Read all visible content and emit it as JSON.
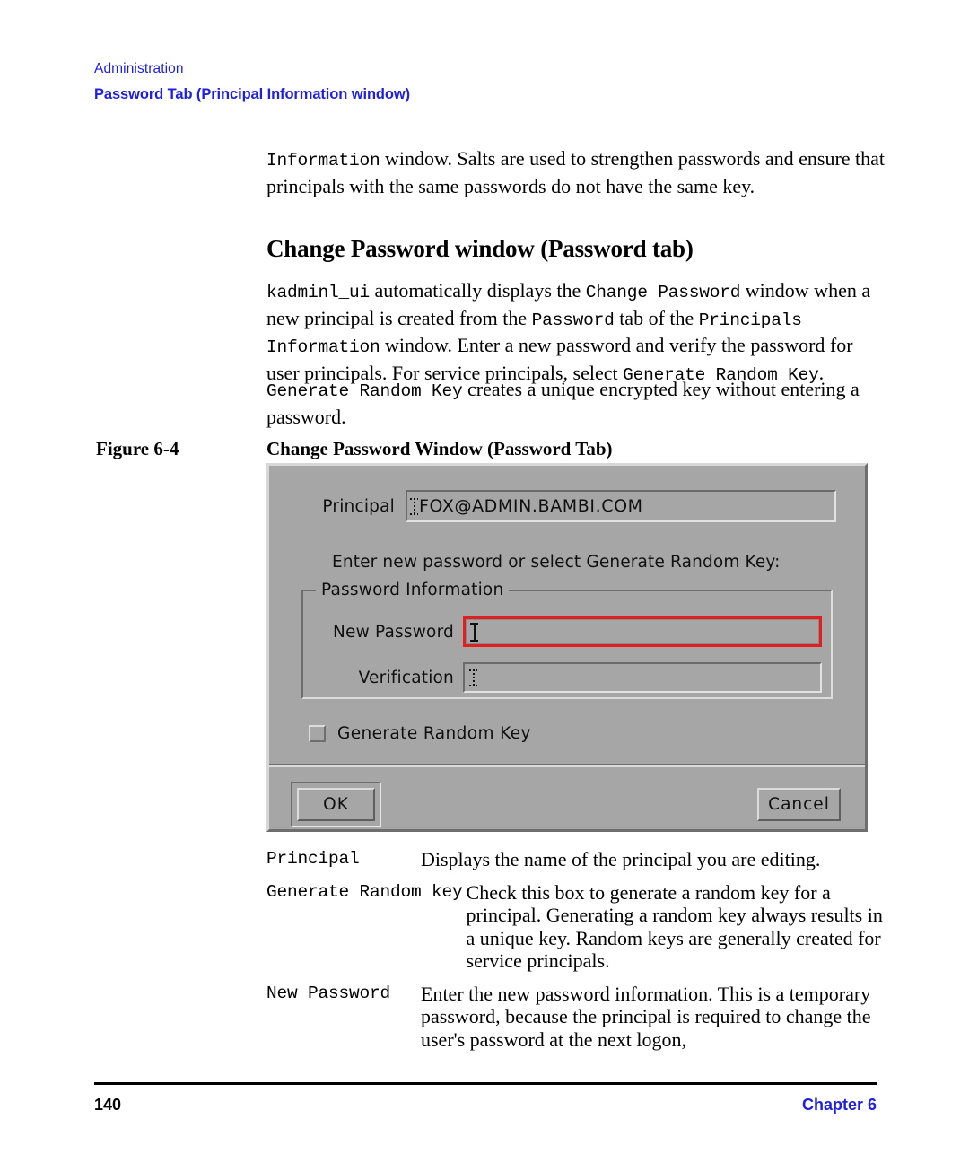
{
  "header": {
    "section": "Administration",
    "title": "Password Tab (Principal Information window)",
    "accent_color": "#1f1fe0"
  },
  "intro_paragraph": {
    "mono_lead": "Information",
    "rest": " window. Salts are used to strengthen passwords and ensure that principals with the same passwords do not have the same key."
  },
  "section_heading": "Change Password window (Password tab)",
  "paragraph_1": {
    "p1": "kadminl_ui",
    "p2": " automatically displays the ",
    "p3": "Change Password",
    "p4": " window when a new principal is created from the ",
    "p5": "Password",
    "p6": " tab of the ",
    "p7": "Principals Information",
    "p8": " window. Enter a new password and verify the password for user principals. For service principals, select ",
    "p9": "Generate Random Key",
    "p10": "."
  },
  "paragraph_2": {
    "p1": "Generate Random Key",
    "p2": " creates a unique encrypted key without entering a password."
  },
  "figure": {
    "label": "Figure 6-4",
    "title": "Change Password Window (Password Tab)"
  },
  "dialog": {
    "background_color": "#a6a6a6",
    "focus_color": "#e02020",
    "principal_label": "Principal",
    "principal_value": "FOX@ADMIN.BAMBI.COM",
    "prompt": "Enter new password or select Generate Random Key:",
    "group_legend": "Password Information",
    "new_password_label": "New Password",
    "new_password_value": "",
    "verification_label": "Verification",
    "verification_value": "",
    "checkbox_label": "Generate Random Key",
    "checkbox_checked": false,
    "ok_button": "OK",
    "cancel_button": "Cancel"
  },
  "definitions": [
    {
      "term": "Principal",
      "desc": "Displays the name of the principal you are editing."
    },
    {
      "term": "Generate Random key",
      "desc": "Check this box to generate a random key for a principal. Generating a random key always results in a unique key. Random keys are generally created for service principals."
    },
    {
      "term": "New Password",
      "desc": "Enter the new password information. This is a temporary password, because the principal is required to change the user's password at the next logon,"
    }
  ],
  "footer": {
    "page_number": "140",
    "chapter": "Chapter 6"
  }
}
